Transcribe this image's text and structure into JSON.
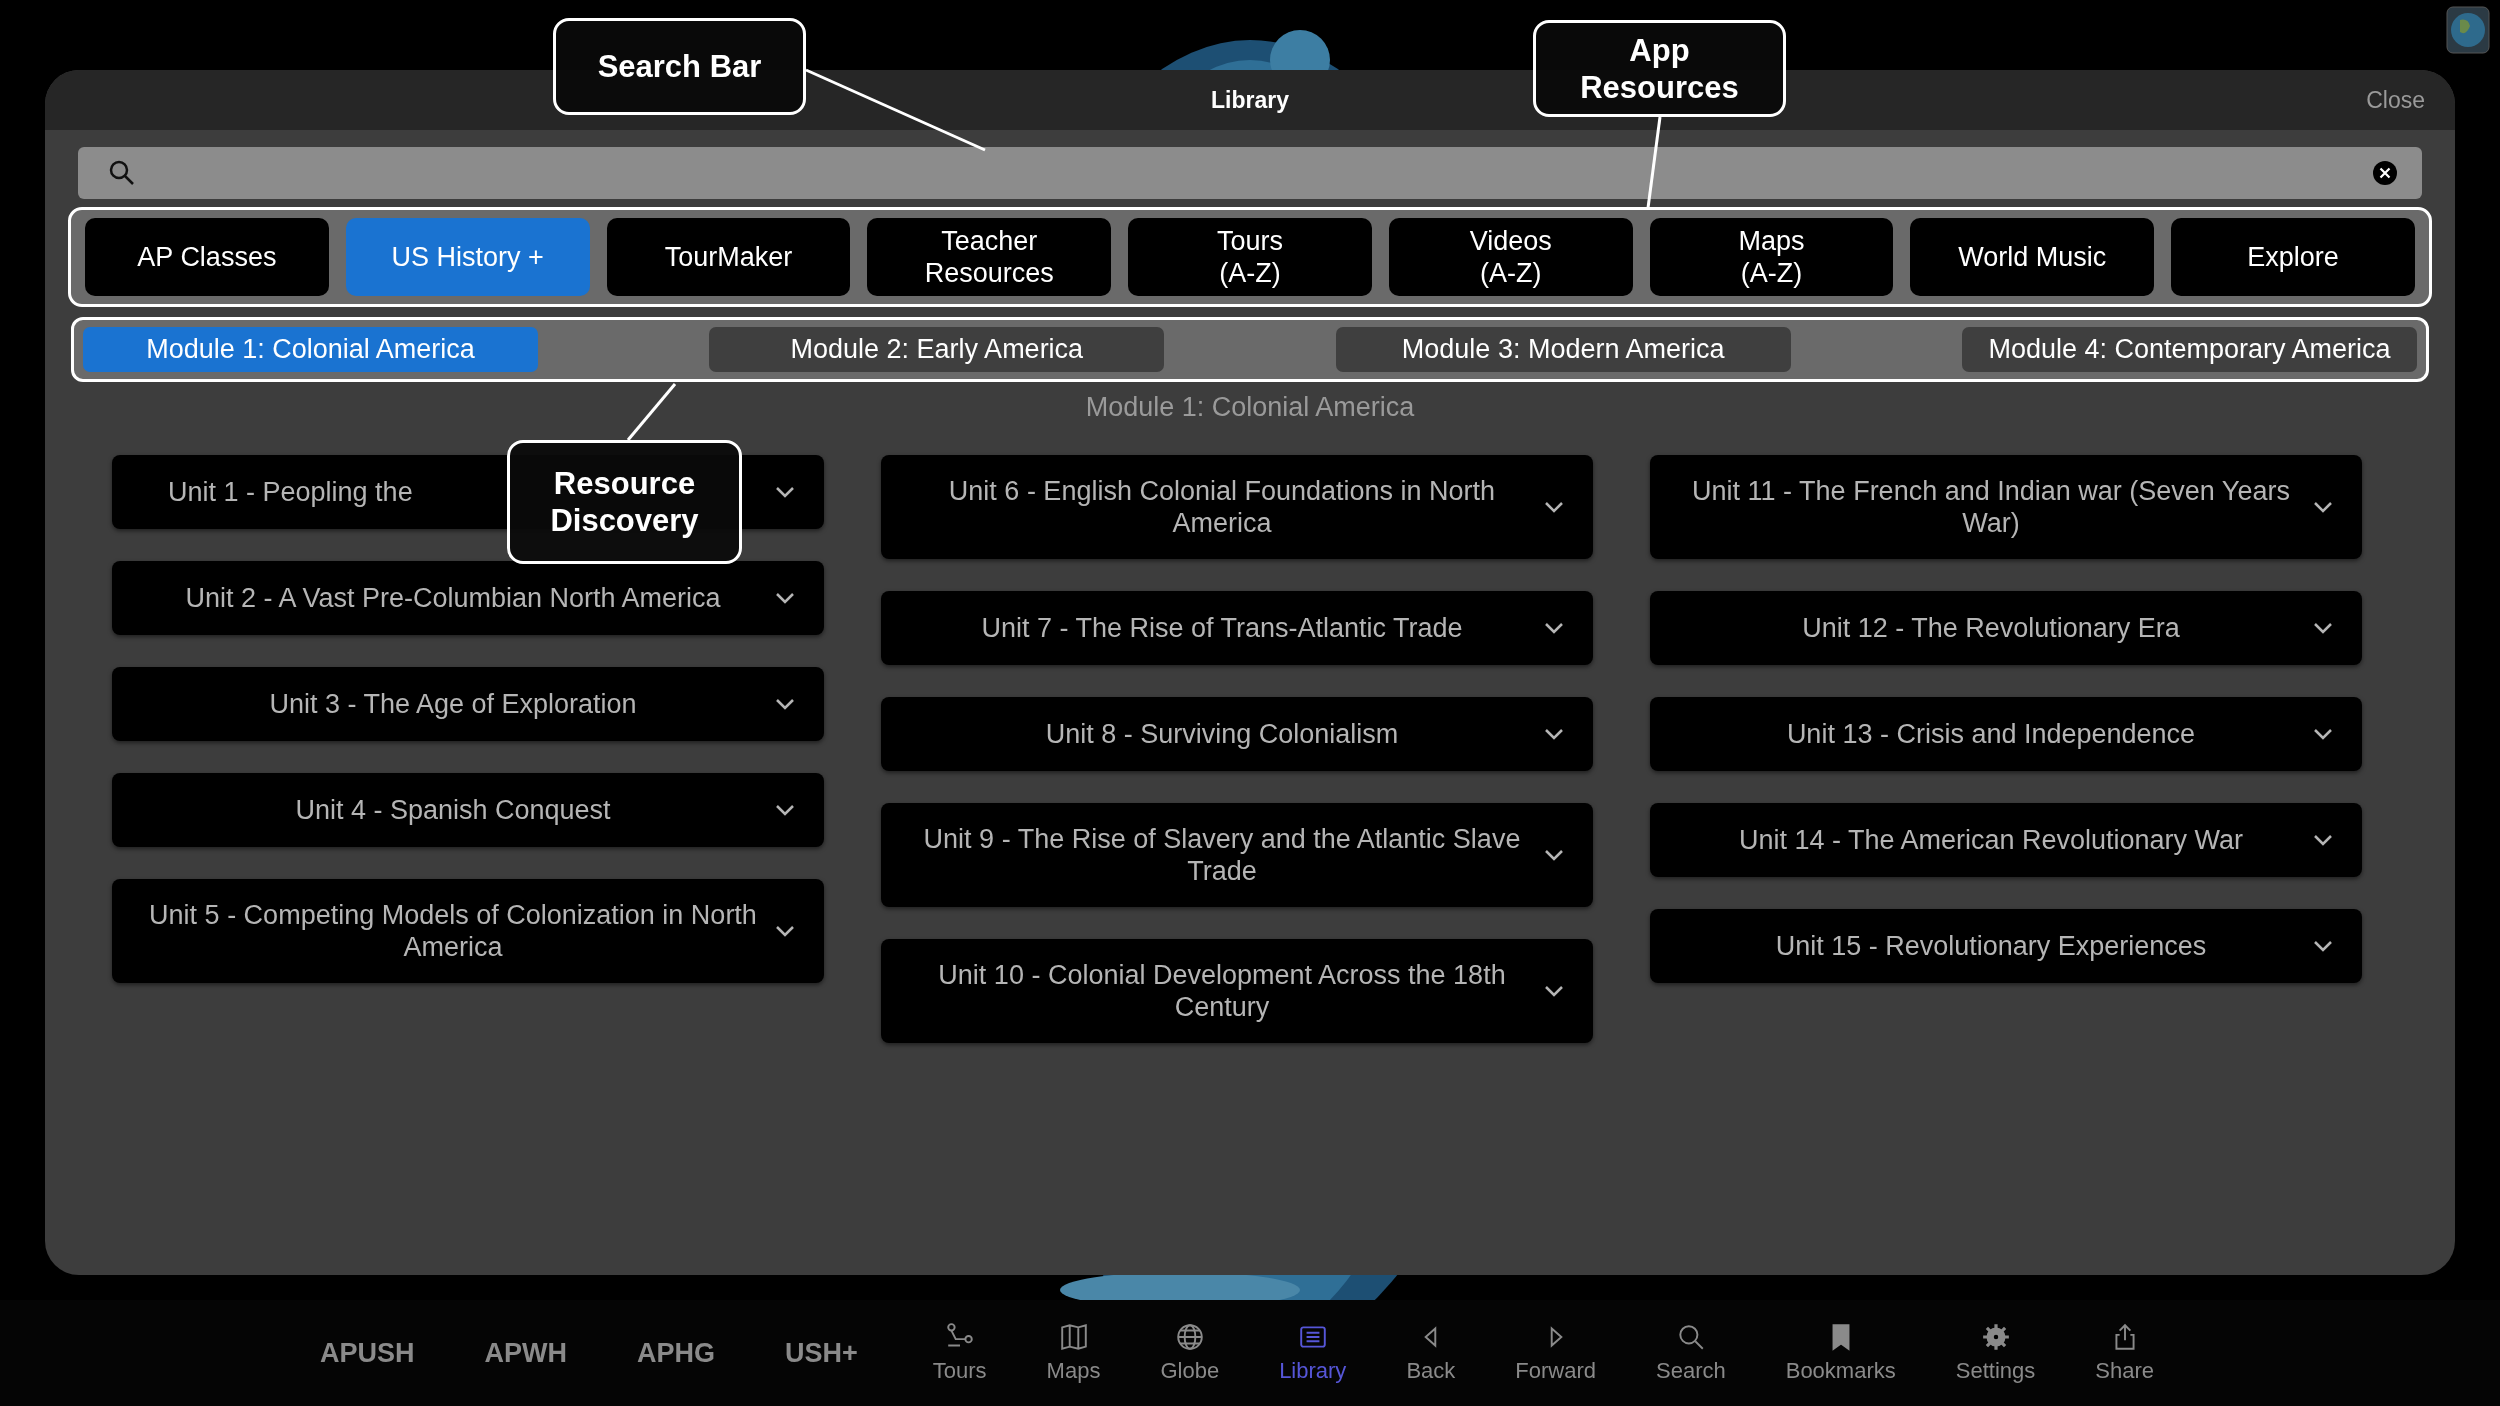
{
  "window": {
    "title": "Library",
    "close": "Close"
  },
  "tabs": [
    {
      "lines": [
        "AP Classes"
      ],
      "selected": false
    },
    {
      "lines": [
        "US History +"
      ],
      "selected": true
    },
    {
      "lines": [
        "TourMaker"
      ],
      "selected": false
    },
    {
      "lines": [
        "Teacher",
        "Resources"
      ],
      "selected": false
    },
    {
      "lines": [
        "Tours",
        "(A-Z)"
      ],
      "selected": false
    },
    {
      "lines": [
        "Videos",
        "(A-Z)"
      ],
      "selected": false
    },
    {
      "lines": [
        "Maps",
        "(A-Z)"
      ],
      "selected": false
    },
    {
      "lines": [
        "World Music"
      ],
      "selected": false
    },
    {
      "lines": [
        "Explore"
      ],
      "selected": false
    }
  ],
  "modules": [
    {
      "label": "Module 1: Colonial America",
      "selected": true
    },
    {
      "label": "Module 2: Early America",
      "selected": false
    },
    {
      "label": "Module 3: Modern America",
      "selected": false
    },
    {
      "label": "Module 4: Contemporary America",
      "selected": false
    }
  ],
  "module_heading": "Module 1: Colonial America",
  "unit_columns": [
    [
      "Unit 1 - Peopling the",
      "Unit 2 - A Vast Pre-Columbian North America",
      "Unit 3 - The Age of Exploration",
      "Unit 4 - Spanish Conquest",
      "Unit 5 - Competing Models of Colonization in North America"
    ],
    [
      "Unit 6 - English Colonial Foundations in North America",
      "Unit 7 - The Rise of Trans-Atlantic Trade",
      "Unit 8 - Surviving Colonialism",
      "Unit 9 - The Rise of Slavery and the Atlantic Slave Trade",
      "Unit 10 - Colonial Development Across the 18th Century"
    ],
    [
      "Unit 11 - The French and Indian war (Seven Years War)",
      "Unit 12 - The Revolutionary Era",
      "Unit 13 - Crisis and Independence",
      "Unit 14 - The American Revolutionary War",
      "Unit 15 - Revolutionary Experiences"
    ]
  ],
  "callouts": [
    {
      "text": "Search Bar"
    },
    {
      "text": "App Resources"
    },
    {
      "text": "Resource Discovery"
    }
  ],
  "toolbar": {
    "shortcuts": [
      "APUSH",
      "APWH",
      "APHG",
      "USH+"
    ],
    "items": [
      {
        "label": "Tours",
        "kind": "tours",
        "selected": false
      },
      {
        "label": "Maps",
        "kind": "maps",
        "selected": false
      },
      {
        "label": "Globe",
        "kind": "globe",
        "selected": false
      },
      {
        "label": "Library",
        "kind": "library",
        "selected": true
      },
      {
        "label": "Back",
        "kind": "back",
        "selected": false
      },
      {
        "label": "Forward",
        "kind": "forward",
        "selected": false
      },
      {
        "label": "Search",
        "kind": "search",
        "selected": false
      },
      {
        "label": "Bookmarks",
        "kind": "bookmarks",
        "selected": false
      },
      {
        "label": "Settings",
        "kind": "settings",
        "selected": false
      },
      {
        "label": "Share",
        "kind": "share",
        "selected": false
      }
    ]
  }
}
